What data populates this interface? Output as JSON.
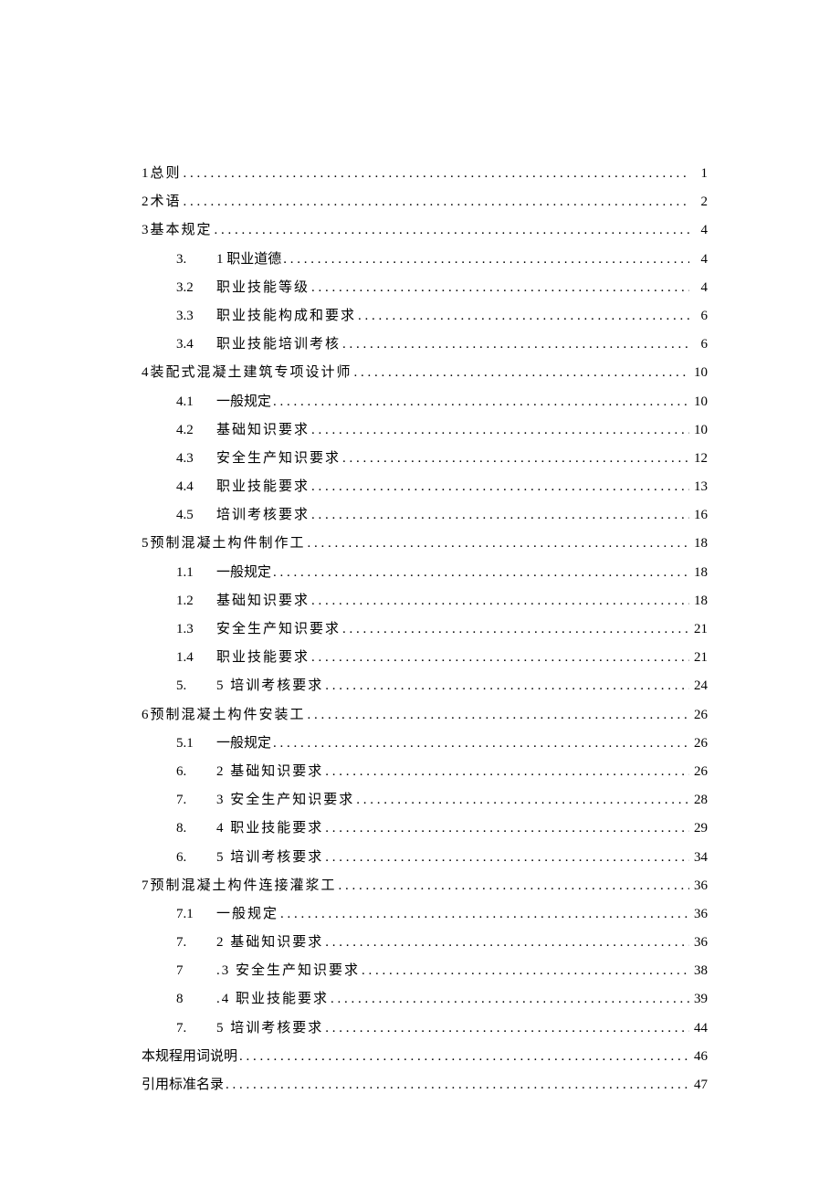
{
  "toc": [
    {
      "level": 0,
      "num": "1",
      "numSpaced": true,
      "text": "总则",
      "textSpaced": true,
      "page": "1"
    },
    {
      "level": 0,
      "num": "2",
      "numSpaced": true,
      "text": "术语",
      "textSpaced": true,
      "page": "2"
    },
    {
      "level": 0,
      "num": "3",
      "numSpaced": true,
      "text": "基本规定",
      "textSpaced": true,
      "page": "4"
    },
    {
      "level": 1,
      "sub": "3.",
      "text": "1 职业道德",
      "page": "4"
    },
    {
      "level": 1,
      "sub": "3.2",
      "text": "职业技能等级",
      "textSpaced": true,
      "page": "4"
    },
    {
      "level": 1,
      "sub": "3.3",
      "text": "职业技能构成和要求",
      "textSpaced": true,
      "page": "6"
    },
    {
      "level": 1,
      "sub": "3.4",
      "text": "职业技能培训考核",
      "textSpaced": true,
      "page": "6"
    },
    {
      "level": 0,
      "num": "4",
      "numSpaced": true,
      "text": "装配式混凝土建筑专项设计师",
      "textSpaced": true,
      "page": "10"
    },
    {
      "level": 1,
      "sub": "4.1",
      "text": "一般规定",
      "page": "10"
    },
    {
      "level": 1,
      "sub": "4.2",
      "text": "基础知识要求",
      "textSpaced": true,
      "page": "10"
    },
    {
      "level": 1,
      "sub": "4.3",
      "text": "安全生产知识要求",
      "textSpaced": true,
      "page": "12"
    },
    {
      "level": 1,
      "sub": "4.4",
      "text": "职业技能要求",
      "textSpaced": true,
      "page": "13"
    },
    {
      "level": 1,
      "sub": "4.5",
      "text": "培训考核要求",
      "textSpaced": true,
      "page": "16"
    },
    {
      "level": 0,
      "num": "5",
      "numSpaced": true,
      "text": "预制混凝土构件制作工",
      "textSpaced": true,
      "page": "18"
    },
    {
      "level": 1,
      "sub": "1.1",
      "text": "一般规定",
      "page": "18"
    },
    {
      "level": 1,
      "sub": "1.2",
      "text": "基础知识要求",
      "textSpaced": true,
      "page": "18"
    },
    {
      "level": 1,
      "sub": "1.3",
      "text": "安全生产知识要求",
      "textSpaced": true,
      "page": "21"
    },
    {
      "level": 1,
      "sub": "1.4",
      "text": "职业技能要求",
      "textSpaced": true,
      "page": "21"
    },
    {
      "level": 1,
      "sub": "5.",
      "text": "5 培训考核要求",
      "textSpaced": true,
      "page": "24"
    },
    {
      "level": 0,
      "num": "6",
      "numSpaced": true,
      "text": "预制混凝土构件安装工",
      "textSpaced": true,
      "page": "26"
    },
    {
      "level": 1,
      "sub": "5.1",
      "text": "一般规定",
      "page": "26"
    },
    {
      "level": 1,
      "sub": "6.",
      "text": "2 基础知识要求",
      "textSpaced": true,
      "page": "26"
    },
    {
      "level": 1,
      "sub": "7.",
      "text": "3 安全生产知识要求",
      "textSpaced": true,
      "page": "28"
    },
    {
      "level": 1,
      "sub": "8.",
      "text": "4 职业技能要求",
      "textSpaced": true,
      "page": "29"
    },
    {
      "level": 1,
      "sub": "6.",
      "text": "5 培训考核要求",
      "textSpaced": true,
      "page": "34"
    },
    {
      "level": 0,
      "num": "7",
      "numSpaced": true,
      "text": "预制混凝土构件连接灌浆工",
      "textSpaced": true,
      "page": "36"
    },
    {
      "level": 1,
      "sub": "7.1",
      "text": "一般规定",
      "textSpaced": true,
      "page": "36"
    },
    {
      "level": 1,
      "sub": "7.",
      "text": "2 基础知识要求",
      "textSpaced": true,
      "page": "36"
    },
    {
      "level": 1,
      "sub": "7",
      "text": ".3 安全生产知识要求",
      "textSpaced": true,
      "page": "38"
    },
    {
      "level": 1,
      "sub": "8",
      "text": ".4 职业技能要求",
      "textSpaced": true,
      "page": "39"
    },
    {
      "level": 1,
      "sub": "7.",
      "text": "5 培训考核要求",
      "textSpaced": true,
      "page": "44"
    },
    {
      "level": 0,
      "num": "",
      "text": "本规程用词说明",
      "page": "46"
    },
    {
      "level": 0,
      "num": "",
      "text": "引用标准名录",
      "page": "47"
    }
  ]
}
